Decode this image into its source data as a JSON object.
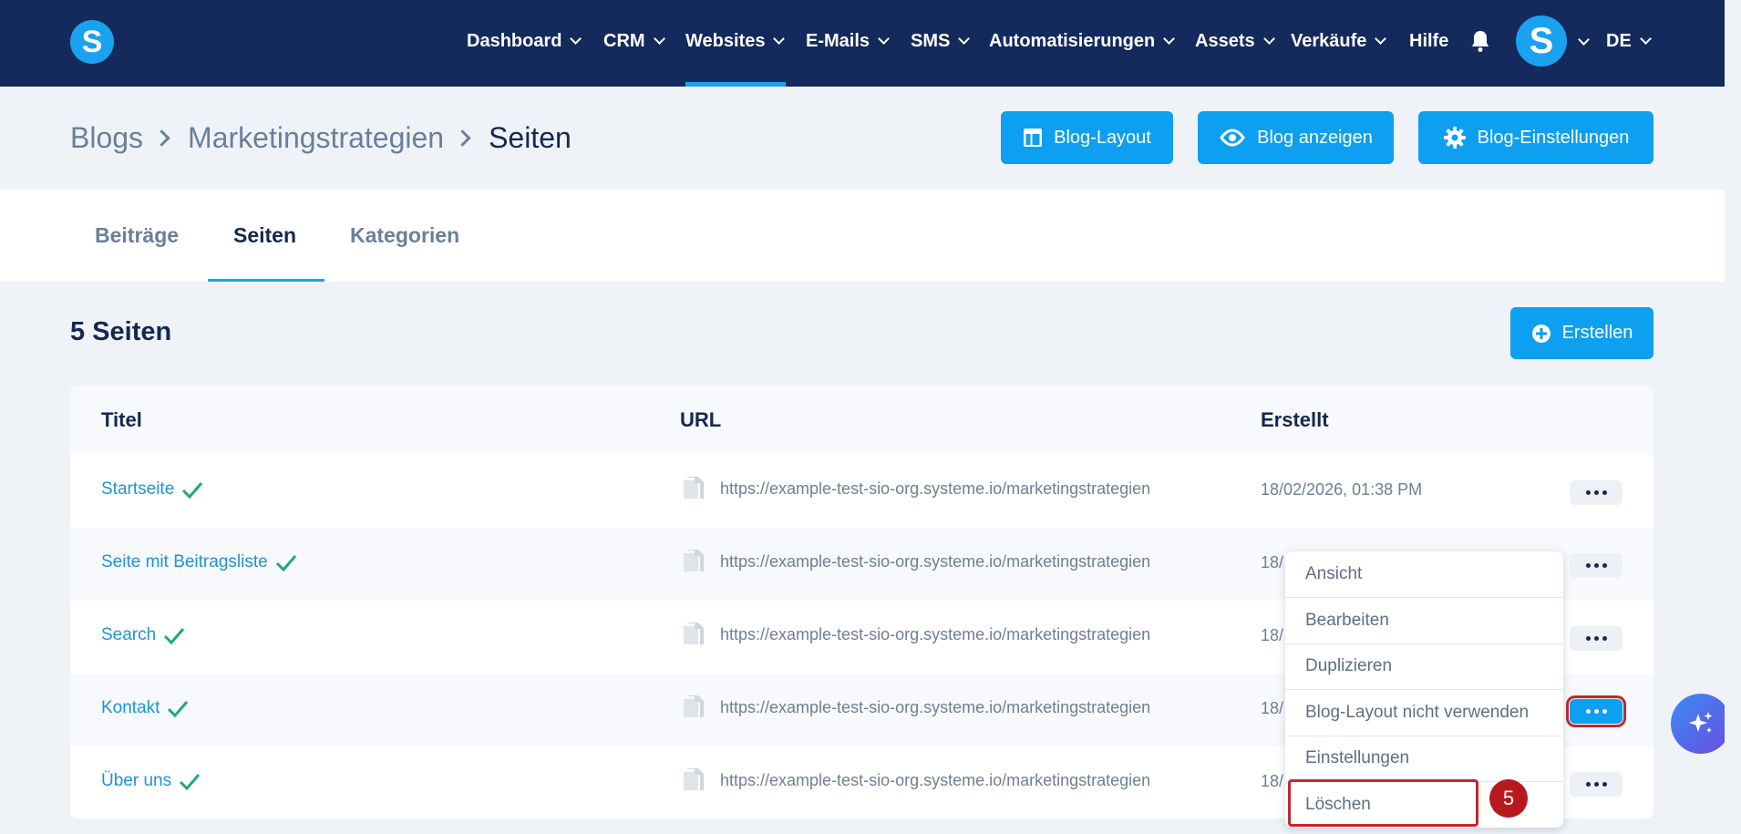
{
  "nav": {
    "logo_letter": "S",
    "items": [
      {
        "label": "Dashboard"
      },
      {
        "label": "CRM"
      },
      {
        "label": "Websites"
      },
      {
        "label": "E-Mails"
      },
      {
        "label": "SMS"
      },
      {
        "label": "Automatisierungen"
      },
      {
        "label": "Assets"
      },
      {
        "label": "Verkäufe"
      }
    ],
    "help": "Hilfe",
    "avatar_letter": "S",
    "language": "DE",
    "active_item": "Websites"
  },
  "breadcrumb": {
    "items": [
      "Blogs",
      "Marketingstrategien"
    ],
    "current": "Seiten"
  },
  "header_buttons": {
    "layout": "Blog-Layout",
    "view": "Blog anzeigen",
    "settings": "Blog-Einstellungen"
  },
  "tabs": [
    {
      "label": "Beiträge"
    },
    {
      "label": "Seiten"
    },
    {
      "label": "Kategorien"
    }
  ],
  "active_tab": "Seiten",
  "list": {
    "title": "5 Seiten",
    "create_label": "Erstellen",
    "columns": {
      "title": "Titel",
      "url": "URL",
      "created": "Erstellt"
    },
    "rows": [
      {
        "title": "Startseite",
        "url": "https://example-test-sio-org.systeme.io/marketingstrategien",
        "created": "18/02/2026, 01:38 PM"
      },
      {
        "title": "Seite mit Beitragsliste",
        "url": "https://example-test-sio-org.systeme.io/marketingstrategien",
        "created": "18/"
      },
      {
        "title": "Search",
        "url": "https://example-test-sio-org.systeme.io/marketingstrategien",
        "created": "18/"
      },
      {
        "title": "Kontakt",
        "url": "https://example-test-sio-org.systeme.io/marketingstrategien",
        "created": "18/"
      },
      {
        "title": "Über uns",
        "url": "https://example-test-sio-org.systeme.io/marketingstrategien",
        "created": "18/"
      }
    ]
  },
  "dropdown": {
    "items": [
      "Ansicht",
      "Bearbeiten",
      "Duplizieren",
      "Blog-Layout nicht verwenden",
      "Einstellungen",
      "Löschen"
    ]
  },
  "annotation": {
    "step": "5"
  },
  "colors": {
    "nav_bg": "#142a5c",
    "accent": "#0d9ff0",
    "link": "#1d94d8",
    "check": "#1ea97c",
    "highlight": "#c0282d"
  }
}
